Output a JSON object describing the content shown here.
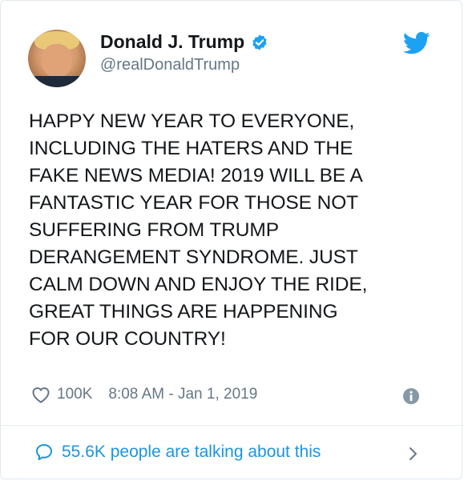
{
  "author": {
    "display_name": "Donald J. Trump",
    "handle": "@realDonaldTrump",
    "verified": true
  },
  "tweet": {
    "text": "HAPPY NEW YEAR TO EVERYONE,\nINCLUDING THE HATERS AND THE\nFAKE NEWS MEDIA! 2019 WILL BE A\nFANTASTIC YEAR FOR THOSE NOT\nSUFFERING FROM TRUMP\nDERANGEMENT SYNDROME. JUST\nCALM DOWN AND ENJOY THE RIDE,\nGREAT THINGS ARE HAPPENING\nFOR OUR COUNTRY!",
    "likes": "100K",
    "timestamp": "8:08 AM - Jan 1, 2019"
  },
  "footer": {
    "talking_label": "55.6K people are talking about this"
  },
  "icons": {
    "brand": "twitter-bird-icon",
    "verified": "verified-badge-icon",
    "like": "heart-icon",
    "info": "info-icon",
    "reply": "speech-bubble-icon",
    "chevron": "chevron-right-icon"
  },
  "colors": {
    "twitter_blue": "#1da1f2",
    "link_blue": "#1b95e0",
    "secondary_text": "#657786",
    "primary_text": "#14171a"
  }
}
